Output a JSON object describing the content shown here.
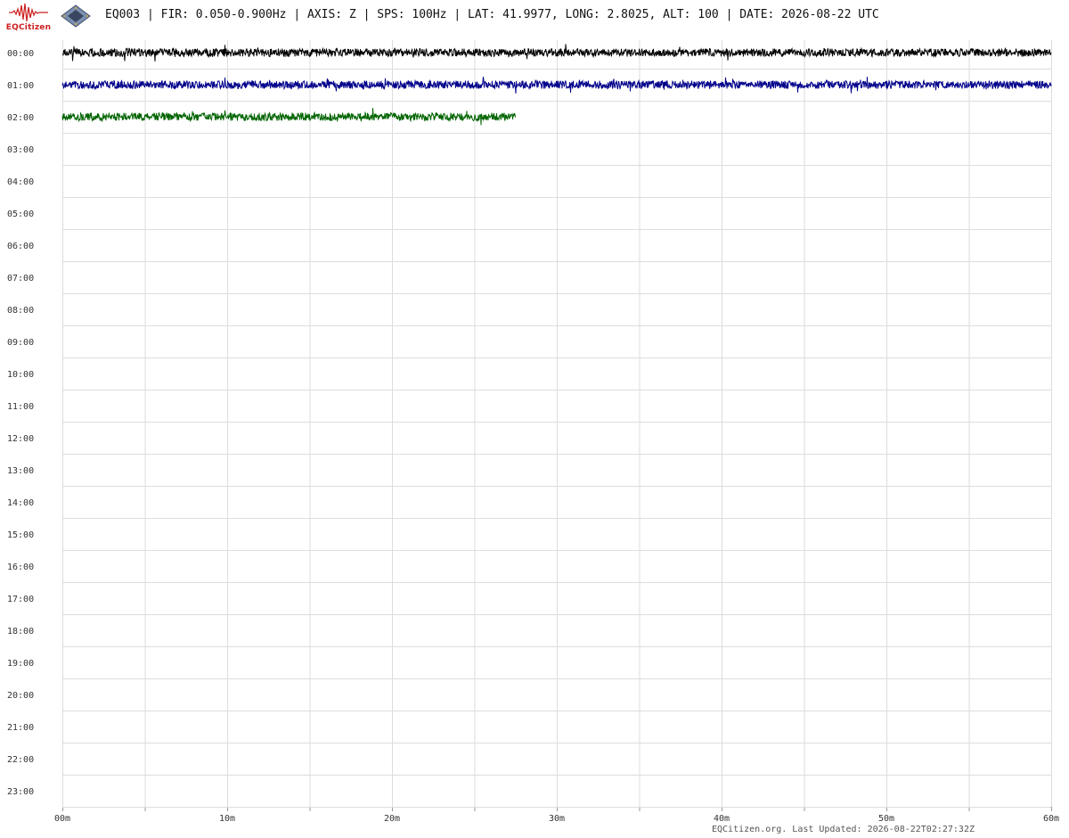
{
  "app": {
    "logo_text": "EQCitizen",
    "header": "EQ003 | FIR: 0.050-0.900Hz | AXIS: Z | SPS: 100Hz | LAT: 41.9977, LONG: 2.8025, ALT: 100 | DATE: 2026-08-22 UTC",
    "footer": "EQCitizen.org. Last Updated: 2026-08-22T02:27:32Z",
    "colors": {
      "grid": "#dddddd",
      "tick": "#333333",
      "brand": "#cc1f1f"
    }
  },
  "chart_data": {
    "type": "line",
    "title": "",
    "xlabel": "",
    "ylabel": "",
    "x_ticks": [
      "00m",
      "10m",
      "20m",
      "30m",
      "40m",
      "50m",
      "60m"
    ],
    "x_range_minutes": [
      0,
      60
    ],
    "x_minor_step_minutes": 5,
    "y_ticks": [
      "00:00",
      "01:00",
      "02:00",
      "03:00",
      "04:00",
      "05:00",
      "06:00",
      "07:00",
      "08:00",
      "09:00",
      "10:00",
      "11:00",
      "12:00",
      "13:00",
      "14:00",
      "15:00",
      "16:00",
      "17:00",
      "18:00",
      "19:00",
      "20:00",
      "21:00",
      "22:00",
      "23:00"
    ],
    "grid": true,
    "series": [
      {
        "hour": "00:00",
        "start_minute": 0,
        "end_minute": 60,
        "color": "#000000"
      },
      {
        "hour": "01:00",
        "start_minute": 0,
        "end_minute": 60,
        "color": "#00008b"
      },
      {
        "hour": "02:00",
        "start_minute": 0,
        "end_minute": 27.5,
        "color": "#006400"
      }
    ]
  }
}
